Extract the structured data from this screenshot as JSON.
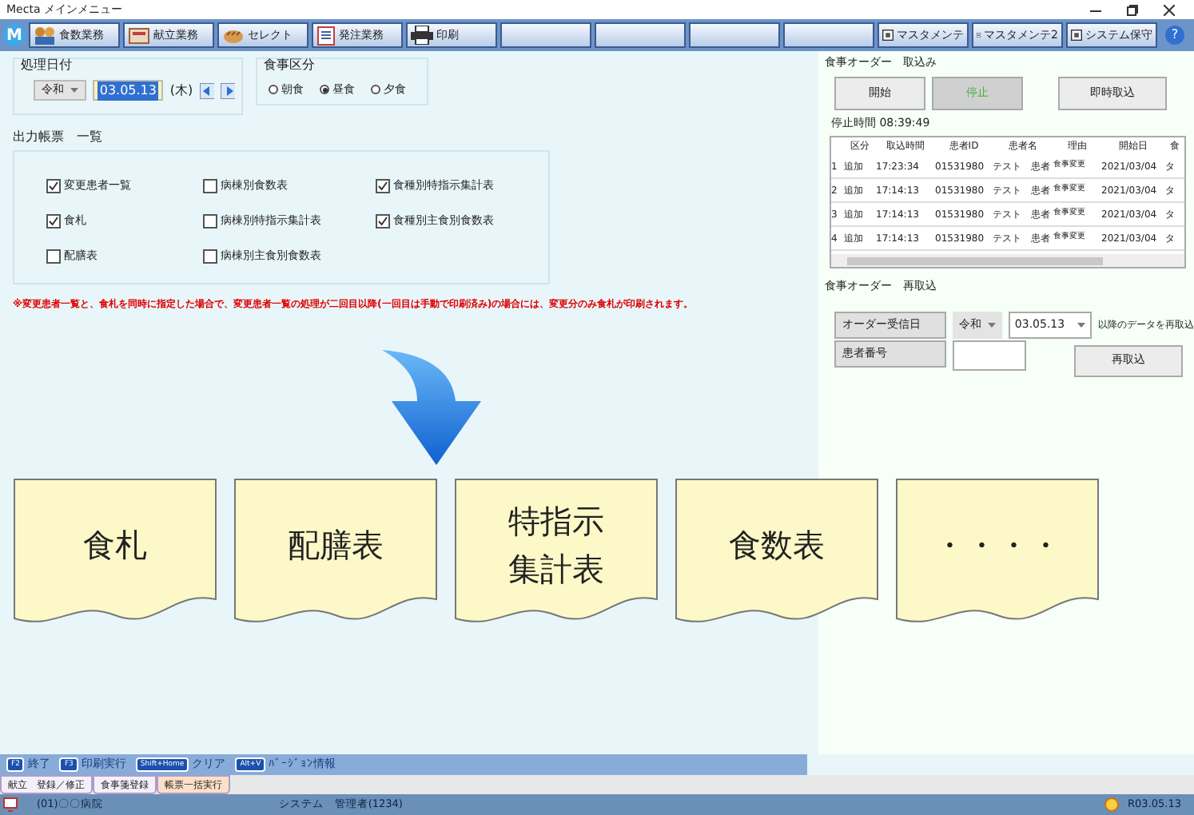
{
  "window": {
    "title": "Mecta メインメニュー"
  },
  "toolbar": [
    {
      "label": "食数業務",
      "kind": "people"
    },
    {
      "label": "献立業務",
      "kind": "box"
    },
    {
      "label": "セレクト",
      "kind": "bread"
    },
    {
      "label": "発注業務",
      "kind": "doc"
    },
    {
      "label": "印刷",
      "kind": "printer"
    },
    {
      "kind": "empty"
    },
    {
      "kind": "empty"
    },
    {
      "kind": "empty"
    },
    {
      "kind": "empty"
    },
    {
      "label": "マスタメンテ",
      "kind": "square"
    },
    {
      "label": "マスタメンテ2",
      "kind": "square"
    },
    {
      "label": "システム保守",
      "kind": "square"
    }
  ],
  "logo": "M",
  "help": "?",
  "date_group": {
    "title": "処理日付",
    "era": "令和",
    "date": "03.05.13",
    "weekday": "(木)"
  },
  "meal_group": {
    "title": "食事区分",
    "options": [
      {
        "label": "朝食",
        "selected": false
      },
      {
        "label": "昼食",
        "selected": true
      },
      {
        "label": "夕食",
        "selected": false
      }
    ]
  },
  "reports": {
    "title": "出力帳票　一覧",
    "columns": [
      [
        {
          "label": "変更患者一覧",
          "checked": true
        },
        {
          "label": "食札",
          "checked": true
        },
        {
          "label": "配膳表",
          "checked": false
        }
      ],
      [
        {
          "label": "病棟別食数表",
          "checked": false
        },
        {
          "label": "病棟別特指示集計表",
          "checked": false
        },
        {
          "label": "病棟別主食別食数表",
          "checked": false
        }
      ],
      [
        {
          "label": "食種別特指示集計表",
          "checked": true
        },
        {
          "label": "食種別主食別食数表",
          "checked": true
        }
      ]
    ]
  },
  "note": "※変更患者一覧と、食札を同時に指定した場合で、変更患者一覧の処理が二回目以降(一回目は手動で印刷済み)の場合には、変更分のみ食札が印刷されます。",
  "documents": [
    {
      "lines": [
        "食札"
      ]
    },
    {
      "lines": [
        "配膳表"
      ]
    },
    {
      "lines": [
        "特指示",
        "集計表"
      ]
    },
    {
      "lines": [
        "食数表"
      ]
    },
    {
      "lines": [
        "・・・・"
      ]
    }
  ],
  "order_import": {
    "title": "食事オーダー　取込み",
    "buttons": [
      {
        "label": "開始",
        "active": false
      },
      {
        "label": "停止",
        "active": true
      },
      {
        "label": "即時取込",
        "active": false
      }
    ],
    "stop_time": "停止時間 08:39:49",
    "columns": [
      "",
      "区分",
      "取込時間",
      "患者ID",
      "患者名",
      "理由",
      "開始日",
      "食"
    ],
    "rows": [
      [
        "1",
        "追加",
        "17:23:34",
        "01531980",
        "テスト　患者",
        "食事変更",
        "2021/03/04",
        "タ"
      ],
      [
        "2",
        "追加",
        "17:14:13",
        "01531980",
        "テスト　患者",
        "食事変更",
        "2021/03/04",
        "タ"
      ],
      [
        "3",
        "追加",
        "17:14:13",
        "01531980",
        "テスト　患者",
        "食事変更",
        "2021/03/04",
        "タ"
      ],
      [
        "4",
        "追加",
        "17:14:13",
        "01531980",
        "テスト　患者",
        "食事変更",
        "2021/03/04",
        "タ"
      ]
    ]
  },
  "reimport": {
    "title": "食事オーダー　再取込",
    "date_label": "オーダー受信日",
    "era": "令和",
    "date": "03.05.13",
    "suffix": "以降のデータを再取込",
    "patient_label": "患者番号",
    "button": "再取込"
  },
  "function_keys": [
    {
      "key": "F2",
      "label": "終了"
    },
    {
      "key": "F3",
      "label": "印刷実行"
    },
    {
      "key": "Shift+Home",
      "label": "クリア"
    },
    {
      "key": "Alt+V",
      "label": "ﾊﾞｰｼﾞｮﾝ情報"
    }
  ],
  "tabs": [
    {
      "label": "献立　登録／修正",
      "selected": false
    },
    {
      "label": "食事箋登録",
      "selected": false
    },
    {
      "label": "帳票一括実行",
      "selected": true
    }
  ],
  "status_bar": {
    "hospital": "(01)〇〇病院",
    "user": "システム　管理者(1234)",
    "date": "R03.05.13"
  }
}
